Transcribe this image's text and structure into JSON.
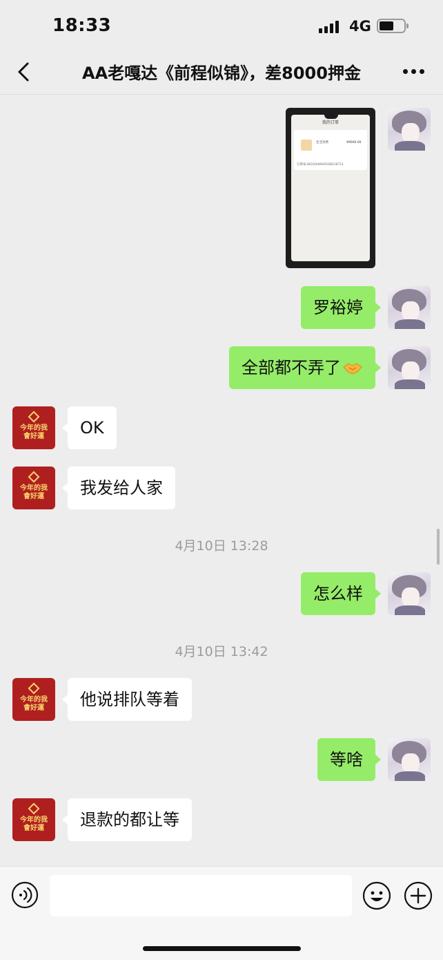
{
  "status_bar": {
    "time": "18:33",
    "network": "4G"
  },
  "header": {
    "title": "AA老嘎达《前程似锦》，差8000押金"
  },
  "image_message": {
    "header": "我的订单",
    "lines": [
      "生活消费",
      "¥9000.00",
      "订单号:84220469/0548218711"
    ]
  },
  "messages": [
    {
      "sender": "me",
      "text": "罗裕婷"
    },
    {
      "sender": "me",
      "text": "全部都不弄了"
    },
    {
      "sender": "other",
      "text": "OK"
    },
    {
      "sender": "other",
      "text": "我发给人家"
    },
    {
      "sender": "me",
      "text": "怎么样"
    },
    {
      "sender": "other",
      "text": "他说排队等着"
    },
    {
      "sender": "me",
      "text": "等啥"
    },
    {
      "sender": "other",
      "text": "退款的都让等"
    }
  ],
  "timestamps": [
    "4月10日 13:28",
    "4月10日 13:42"
  ],
  "contact_avatar_text": [
    "今年的我",
    "會好運"
  ],
  "input": {
    "value": "",
    "placeholder": ""
  },
  "colors": {
    "my_bubble": "#95ec69",
    "their_bubble": "#ffffff",
    "background": "#ededed"
  },
  "icons": [
    "back-icon",
    "more-icon",
    "voice-icon",
    "emoji-icon",
    "plus-icon"
  ]
}
